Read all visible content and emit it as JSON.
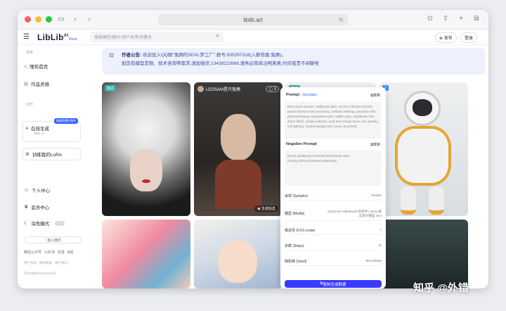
{
  "browser": {
    "url": "liblib.art"
  },
  "header": {
    "logo": "LibLib",
    "logo_ai": "AI",
    "logo_beta": "Beta",
    "search_placeholder": "搜索模型/图片/用户名等关键词",
    "publish_label": "发布",
    "login_label": "登录"
  },
  "sidebar": {
    "section_explore": "探索",
    "items_top": [
      {
        "label": "哩布首页",
        "icon": "home-icon"
      },
      {
        "label": "作品灵感",
        "icon": "bulb-icon"
      }
    ],
    "section_create": "创作",
    "online_gen": {
      "label": "在线生成",
      "sub": "Web UI",
      "tag": "邀请免费内测中"
    },
    "train_lora": "训练我的LoRA",
    "personal": "个人中心",
    "member": "会员中心",
    "dark_mode": "深色模式",
    "join_us": "加入我们",
    "footer_links": [
      "微信公众号",
      "小红书",
      "抖音",
      "B站"
    ],
    "footer_legal": [
      "用户协议",
      "隐私政策",
      "关于我们"
    ],
    "icp": "京ICP备2023015442号"
  },
  "notice": {
    "title": "作者公告:",
    "line1": "欢迎加入QQ群\"兔狮的SDXL梦工厂\",群号:835297318(入群答案:兔狮)。",
    "line2": "如您有模型定制、技术咨询等需求,请加微信:13439222668,请务必简单注明来意,时间宝贵不闲聊哈"
  },
  "cards": [
    {
      "badge": "直返"
    },
    {
      "author": "LEOSAM是只兔狮",
      "count": "3",
      "gen_info": "生成信息"
    },
    {
      "badge": "直返"
    },
    {
      "badge": "3"
    }
  ],
  "panel": {
    "prompt_label": "Prompt",
    "prompt_tag": "TEXT2IMG",
    "copy_label": "复制",
    "prompt_text": "East Asian woman, traditional attire, ancient Chinese fashion, peach blossom hair accessory, delicate makeup, porcelain skin, ethereal beauty, expressive eyes, subtle gaze, windblown hair, sheer fabric, ornate patterns, gold and orange tones, fine jewelry, soft lighting, neutral background, close-up portrait,",
    "neg_label": "Negative Prompt",
    "neg_text": "(worst quality,low resolution,bad hands,open mouth),distorted,twisted,watermark,",
    "params": [
      {
        "k": "采样 (Sampler)",
        "v": "Restart"
      },
      {
        "k": "模型 (Model)",
        "v": "LEOSAM HelloWorld 新世界 | SDXL真实感大模型 v5.0"
      },
      {
        "k": "相关性 (CFG scale)",
        "v": "7"
      },
      {
        "k": "步数 (Steps)",
        "v": "21"
      },
      {
        "k": "随机种 (Seed)",
        "v": "961326582"
      }
    ],
    "gen_button": "复制生成数据"
  },
  "watermark": "知乎 @外错"
}
